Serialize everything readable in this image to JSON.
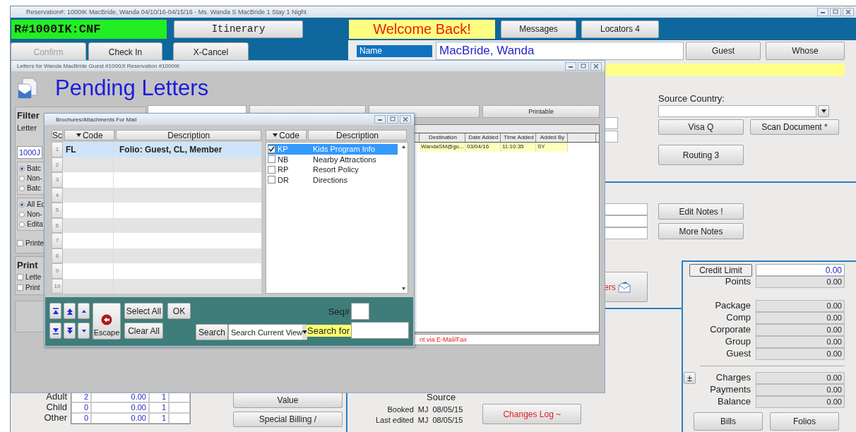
{
  "main_window": {
    "title": "Reservation#: 1000IK MacBride, Wanda 04/10/16-04/15/16 - Ms. Wanda S MacBride 1 Stay 1 Night",
    "reservation_code": "R#1000IK:CNF",
    "itinerary_button": "Itinerary",
    "welcome_banner": "Welcome Back!",
    "top_buttons": [
      "Messages",
      "Locators 4"
    ],
    "action_buttons": [
      {
        "label": "Confirm",
        "disabled": true
      },
      {
        "label": "Check In",
        "disabled": false
      },
      {
        "label": "X-Cancel",
        "disabled": false
      }
    ],
    "name_label": "Name",
    "name_value": "MacBride, Wanda",
    "name_buttons": [
      "Guest",
      "Whose"
    ],
    "source_country_label": "Source Country:",
    "id_buttons": [
      "Visa Q",
      "Scan Document *"
    ],
    "routing_button": "Routing 3",
    "notes_buttons": [
      "Edit Notes !",
      "More Notes"
    ],
    "letters_button": "ers",
    "credit_limit": {
      "button": "Credit Limit",
      "value": "0.00"
    },
    "points": [
      {
        "label": "Points",
        "value": "0.00"
      }
    ],
    "allowances": [
      {
        "label": "Package",
        "value": "0.00"
      },
      {
        "label": "Comp",
        "value": "0.00"
      },
      {
        "label": "Corporate",
        "value": "0.00"
      },
      {
        "label": "Group",
        "value": "0.00"
      },
      {
        "label": "Guest",
        "value": "0.00"
      }
    ],
    "expand_button": "±",
    "balances": [
      {
        "label": "Charges",
        "value": "0.00"
      },
      {
        "label": "Payments",
        "value": "0.00"
      },
      {
        "label": "Balance",
        "value": "0.00"
      }
    ],
    "billing_buttons": [
      "Bills",
      "Folios"
    ],
    "occupants": [
      {
        "type": "Adult",
        "count": "2",
        "amount": "0.00",
        "nights": "1"
      },
      {
        "type": "Child",
        "count": "0",
        "amount": "0.00",
        "nights": "1"
      },
      {
        "type": "Other",
        "count": "0",
        "amount": "0.00",
        "nights": "1"
      }
    ],
    "value_buttons": [
      "Value",
      "Special Billing /"
    ],
    "source_label": "Source",
    "audit": [
      {
        "label": "Booked",
        "user": "MJ",
        "date": "08/05/15"
      },
      {
        "label": "Last edited",
        "user": "MJ",
        "date": "08/05/15"
      }
    ],
    "changes_log_button": "Changes Log ~"
  },
  "letters_dialog": {
    "title": "Letters for Wanda MacBride Guest #1000JI Reservation #1000IK",
    "heading": "Pending Letters",
    "filter": {
      "title": "Filter",
      "letter_label": "Letter",
      "letter_value": "1000J",
      "batch_options": [
        {
          "label": "Batc",
          "selected": true
        },
        {
          "label": "Non-",
          "selected": false
        },
        {
          "label": "Batc",
          "selected": false
        }
      ],
      "edit_options": [
        {
          "label": "All Ec",
          "selected": true
        },
        {
          "label": "Non-",
          "selected": false
        },
        {
          "label": "Edita",
          "selected": false
        }
      ],
      "printed": {
        "label": "Printe",
        "checked": false
      }
    },
    "print_options": {
      "title": "Print",
      "options": [
        {
          "label": "Lette",
          "checked": false
        },
        {
          "label": "Print",
          "checked": false
        }
      ]
    },
    "tabs": [
      {
        "selected": true
      },
      {
        "selected": false
      },
      {
        "selected": false
      },
      {
        "label": "Printable",
        "selected": false
      }
    ],
    "table": {
      "columns": [
        "Destination",
        "Date Added",
        "Time Added",
        "Added By"
      ],
      "rows": [
        [
          "WandaSM@gu...",
          "03/04/16",
          "11:10:35",
          "SY"
        ]
      ]
    },
    "status_text": "nt via E-Mail/Fax"
  },
  "brochures_dialog": {
    "title": "Brochures/Attachments For Mail",
    "selected_columns": [
      "Sc",
      "Code",
      "Description"
    ],
    "selected_rows": [
      {
        "seq": "1",
        "code": "FL",
        "description": "Folio: Guest, CL, Member",
        "selected": true
      },
      {
        "seq": "2",
        "selected": false
      },
      {
        "seq": "3",
        "selected": false
      },
      {
        "seq": "4",
        "selected": false
      },
      {
        "seq": "5",
        "selected": false
      },
      {
        "seq": "6",
        "selected": false
      },
      {
        "seq": "7",
        "selected": false
      },
      {
        "seq": "8",
        "selected": false
      },
      {
        "seq": "9",
        "selected": false
      },
      {
        "seq": "10",
        "selected": false
      }
    ],
    "available_columns": [
      "Code",
      "Description"
    ],
    "available_items": [
      {
        "code": "KP",
        "description": "Kids Program Info",
        "checked": true,
        "selected": true
      },
      {
        "code": "NB",
        "description": "Nearby Attractions",
        "checked": false,
        "selected": false
      },
      {
        "code": "RP",
        "description": "Resort Policy",
        "checked": false,
        "selected": false
      },
      {
        "code": "DR",
        "description": "Directions",
        "checked": false,
        "selected": false
      }
    ],
    "escape_button": "Escape",
    "select_all_button": "Select All",
    "ok_button": "OK",
    "clear_all_button": "Clear All",
    "search_button": "Search",
    "search_scope": "Search Current View",
    "seq_label": "Seq#",
    "search_for_label": "Search for"
  }
}
